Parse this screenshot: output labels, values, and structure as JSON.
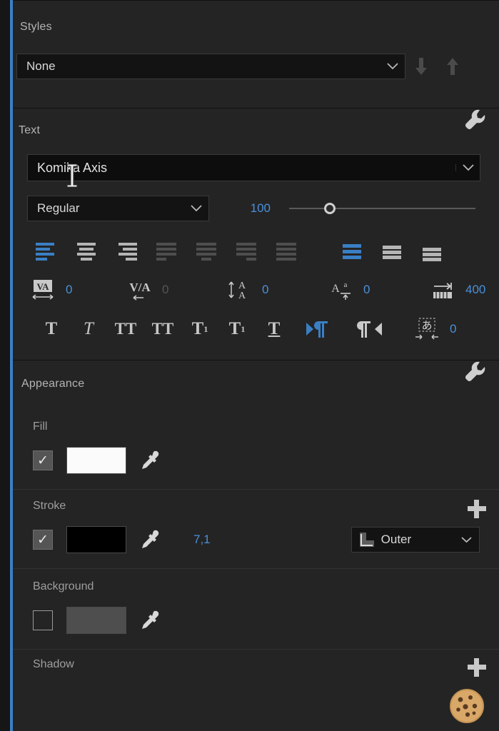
{
  "panel": {
    "accent_color": "#3a7fc4",
    "background": "#242424",
    "value_color": "#4a90d9"
  },
  "styles": {
    "title": "Styles",
    "selected": "None",
    "push_icon": "arrow-down-icon",
    "pull_icon": "arrow-up-icon"
  },
  "text": {
    "title": "Text",
    "settings_icon": "wrench-icon",
    "font_family": "Komika Axis",
    "font_style": "Regular",
    "font_size": "100",
    "size_slider_percent": 22,
    "align": {
      "left": "align-left",
      "center": "align-center",
      "right": "align-right",
      "justify_last_left": "justify-last-left",
      "justify_last_center": "justify-last-center",
      "justify_last_right": "justify-last-right",
      "justify_all": "justify-all",
      "vertical_top": "vertical-align-top",
      "vertical_center": "vertical-align-center",
      "vertical_bottom": "vertical-align-bottom",
      "active_horizontal": "align-left",
      "active_vertical": "vertical-align-top"
    },
    "metrics": [
      {
        "icon": "tracking-icon",
        "value": "0",
        "dim": false
      },
      {
        "icon": "kerning-icon",
        "value": "0",
        "dim": true
      },
      {
        "icon": "leading-icon",
        "value": "0",
        "dim": false
      },
      {
        "icon": "baseline-shift-icon",
        "value": "0",
        "dim": false
      },
      {
        "icon": "text-width-icon",
        "value": "400",
        "dim": false
      }
    ],
    "style_buttons": [
      {
        "name": "faux-bold-button",
        "glyph": "T"
      },
      {
        "name": "faux-italic-button",
        "glyph": "T"
      },
      {
        "name": "all-caps-button",
        "glyph": "TT"
      },
      {
        "name": "small-caps-button",
        "glyph": "TT"
      },
      {
        "name": "superscript-button",
        "glyph": "T"
      },
      {
        "name": "subscript-button",
        "glyph": "T"
      },
      {
        "name": "underline-button",
        "glyph": "T"
      }
    ],
    "paragraph_ltr": "paragraph-ltr-icon",
    "paragraph_rtl": "paragraph-rtl-icon",
    "tsume_icon": "tsume-icon",
    "tsume_value": "0"
  },
  "appearance": {
    "title": "Appearance",
    "settings_icon": "wrench-icon",
    "fill": {
      "label": "Fill",
      "enabled": true,
      "color": "#fbfbfb",
      "eyedropper": "eyedropper-icon"
    },
    "stroke": {
      "label": "Stroke",
      "enabled": true,
      "color": "#000000",
      "eyedropper": "eyedropper-icon",
      "width": "7,1",
      "position": "Outer",
      "position_icon": "stroke-outer-icon",
      "add_icon": "plus-icon"
    },
    "background": {
      "label": "Background",
      "enabled": false,
      "color": "#4e4e4e",
      "eyedropper": "eyedropper-icon"
    },
    "shadow": {
      "label": "Shadow",
      "add_icon": "plus-icon"
    }
  },
  "overlay": {
    "cookie_icon": "cookie-emoji"
  },
  "cursor": {
    "type": "i-beam-text-cursor"
  }
}
